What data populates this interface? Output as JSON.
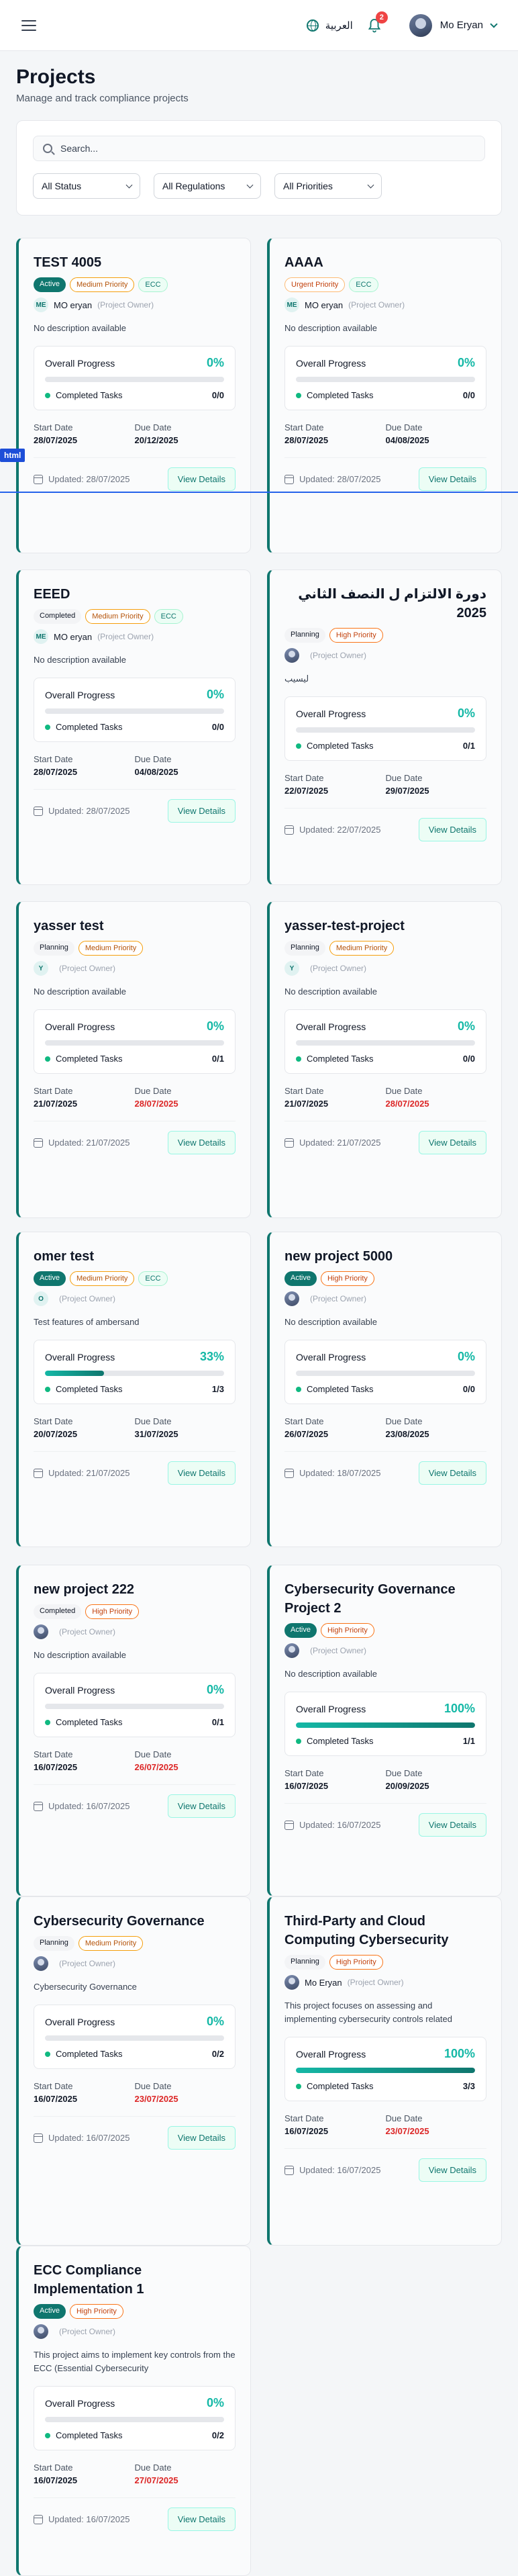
{
  "header": {
    "language_label": "العربية",
    "notification_count": "2",
    "user_name": "Mo Eryan"
  },
  "page": {
    "title": "Projects",
    "subtitle": "Manage and track compliance projects"
  },
  "filters": {
    "search_placeholder": "Search...",
    "status_value": "All Status",
    "regulation_value": "All Regulations",
    "priority_value": "All Priorities"
  },
  "labels": {
    "overall_progress": "Overall Progress",
    "completed_tasks": "Completed Tasks",
    "start_date": "Start Date",
    "due_date": "Due Date",
    "view_details": "View Details",
    "project_owner": "(Project Owner)",
    "updated_prefix": "Updated: "
  },
  "overlay": {
    "tag": "html"
  },
  "projects": [
    {
      "title": "TEST 4005",
      "badges": [
        {
          "text": "Active",
          "kind": "active"
        },
        {
          "text": "Medium Priority",
          "kind": "medium"
        },
        {
          "text": "ECC",
          "kind": "ecc"
        }
      ],
      "owner_initials": "ME",
      "owner_name": "MO eryan",
      "description": "No description available",
      "progress": "0%",
      "progress_value": 0,
      "tasks": "0/0",
      "start": "28/07/2025",
      "due": "20/12/2025",
      "due_overdue": false,
      "updated": "Updated: 28/07/2025"
    },
    {
      "title": "AAAA",
      "badges": [
        {
          "text": "Urgent Priority",
          "kind": "urgent"
        },
        {
          "text": "ECC",
          "kind": "ecc"
        }
      ],
      "owner_initials": "ME",
      "owner_name": "MO eryan",
      "description": "No description available",
      "progress": "0%",
      "progress_value": 0,
      "tasks": "0/0",
      "start": "28/07/2025",
      "due": "04/08/2025",
      "due_overdue": false,
      "updated": "Updated: 28/07/2025"
    },
    {
      "title": "EEED",
      "badges": [
        {
          "text": "Completed",
          "kind": "completed"
        },
        {
          "text": "Medium Priority",
          "kind": "medium"
        },
        {
          "text": "ECC",
          "kind": "ecc"
        }
      ],
      "owner_initials": "ME",
      "owner_name": "MO eryan",
      "description": "No description available",
      "progress": "0%",
      "progress_value": 0,
      "tasks": "0/0",
      "start": "28/07/2025",
      "due": "04/08/2025",
      "due_overdue": false,
      "updated": "Updated: 28/07/2025"
    },
    {
      "title": "دورة الالتزام ل النصف الثاني 2025",
      "rtl": true,
      "badges": [
        {
          "text": "Planning",
          "kind": "planning"
        },
        {
          "text": "High Priority",
          "kind": "high"
        }
      ],
      "owner_initials": "",
      "owner_name": "",
      "description": "ليسيب",
      "progress": "0%",
      "progress_value": 0,
      "tasks": "0/1",
      "start": "22/07/2025",
      "due": "29/07/2025",
      "due_overdue": false,
      "updated": "Updated: 22/07/2025"
    },
    {
      "title": "yasser test",
      "badges": [
        {
          "text": "Planning",
          "kind": "planning"
        },
        {
          "text": "Medium Priority",
          "kind": "medium"
        }
      ],
      "owner_initials": "Y",
      "owner_name": "",
      "description": "No description available",
      "progress": "0%",
      "progress_value": 0,
      "tasks": "0/1",
      "start": "21/07/2025",
      "due": "28/07/2025",
      "due_overdue": true,
      "updated": "Updated: 21/07/2025"
    },
    {
      "title": "yasser-test-project",
      "badges": [
        {
          "text": "Planning",
          "kind": "planning"
        },
        {
          "text": "Medium Priority",
          "kind": "medium"
        }
      ],
      "owner_initials": "Y",
      "owner_name": "",
      "description": "No description available",
      "progress": "0%",
      "progress_value": 0,
      "tasks": "0/0",
      "start": "21/07/2025",
      "due": "28/07/2025",
      "due_overdue": true,
      "updated": "Updated: 21/07/2025"
    },
    {
      "title": "omer test",
      "badges": [
        {
          "text": "Active",
          "kind": "active"
        },
        {
          "text": "Medium Priority",
          "kind": "medium"
        },
        {
          "text": "ECC",
          "kind": "ecc"
        }
      ],
      "owner_initials": "O",
      "owner_name": "",
      "description": "Test features of ambersand",
      "progress": "33%",
      "progress_value": 33,
      "tasks": "1/3",
      "start": "20/07/2025",
      "due": "31/07/2025",
      "due_overdue": false,
      "updated": "Updated: 21/07/2025"
    },
    {
      "title": "new project 5000",
      "badges": [
        {
          "text": "Active",
          "kind": "active"
        },
        {
          "text": "High Priority",
          "kind": "high"
        }
      ],
      "owner_initials": "",
      "owner_name": "",
      "description": "No description available",
      "progress": "0%",
      "progress_value": 0,
      "tasks": "0/0",
      "start": "26/07/2025",
      "due": "23/08/2025",
      "due_overdue": false,
      "updated": "Updated: 18/07/2025"
    },
    {
      "title": "new project 222",
      "badges": [
        {
          "text": "Completed",
          "kind": "completed"
        },
        {
          "text": "High Priority",
          "kind": "high"
        }
      ],
      "owner_initials": "",
      "owner_name": "",
      "description": "No description available",
      "progress": "0%",
      "progress_value": 0,
      "tasks": "0/1",
      "start": "16/07/2025",
      "due": "26/07/2025",
      "due_overdue": true,
      "updated": "Updated: 16/07/2025"
    },
    {
      "title": "Cybersecurity Governance Project 2",
      "badges": [
        {
          "text": "Active",
          "kind": "active"
        },
        {
          "text": "High Priority",
          "kind": "high"
        }
      ],
      "owner_initials": "",
      "owner_name": "",
      "description": "No description available",
      "progress": "100%",
      "progress_value": 100,
      "tasks": "1/1",
      "start": "16/07/2025",
      "due": "20/09/2025",
      "due_overdue": false,
      "updated": "Updated: 16/07/2025"
    },
    {
      "title": "Cybersecurity Governance",
      "badges": [
        {
          "text": "Planning",
          "kind": "planning"
        },
        {
          "text": "Medium Priority",
          "kind": "medium"
        }
      ],
      "owner_initials": "",
      "owner_name": "",
      "description": "Cybersecurity Governance",
      "progress": "0%",
      "progress_value": 0,
      "tasks": "0/2",
      "start": "16/07/2025",
      "due": "23/07/2025",
      "due_overdue": true,
      "updated": "Updated: 16/07/2025"
    },
    {
      "title": "Third-Party and Cloud Computing Cybersecurity",
      "badges": [
        {
          "text": "Planning",
          "kind": "planning"
        },
        {
          "text": "High Priority",
          "kind": "high"
        }
      ],
      "owner_initials": "",
      "owner_name": "Mo Eryan",
      "description": "This project focuses on assessing and implementing cybersecurity controls related",
      "progress": "100%",
      "progress_value": 100,
      "tasks": "3/3",
      "start": "16/07/2025",
      "due": "23/07/2025",
      "due_overdue": true,
      "updated": "Updated: 16/07/2025"
    },
    {
      "title": "ECC Compliance Implementation 1",
      "badges": [
        {
          "text": "Active",
          "kind": "active"
        },
        {
          "text": "High Priority",
          "kind": "high"
        }
      ],
      "owner_initials": "",
      "owner_name": "",
      "description": "This project aims to implement key controls from the ECC (Essential Cybersecurity",
      "progress": "0%",
      "progress_value": 0,
      "tasks": "0/2",
      "start": "16/07/2025",
      "due": "27/07/2025",
      "due_overdue": true,
      "updated": "Updated: 16/07/2025"
    }
  ]
}
